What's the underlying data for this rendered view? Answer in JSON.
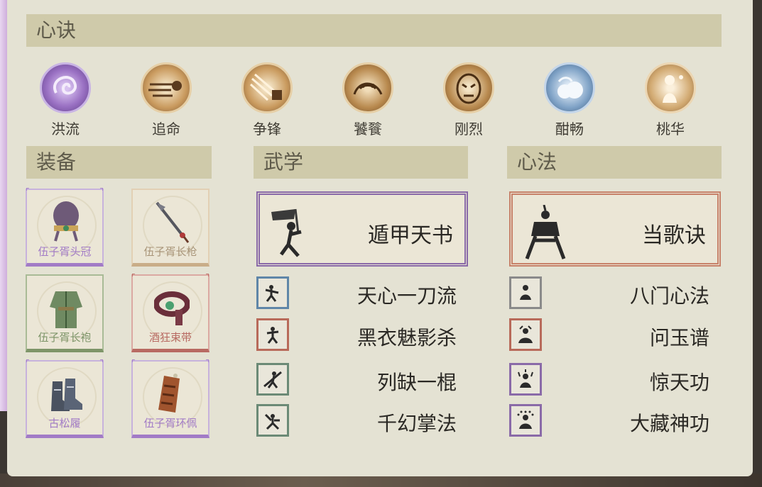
{
  "xinjue": {
    "title": "心诀",
    "items": [
      {
        "label": "洪流",
        "color": "#9b72c4",
        "icon": "swirl-icon"
      },
      {
        "label": "追命",
        "color": "#b78a52",
        "icon": "dash-icon"
      },
      {
        "label": "争锋",
        "color": "#b78a52",
        "icon": "strike-icon"
      },
      {
        "label": "饕餮",
        "color": "#a87a46",
        "icon": "beast-icon"
      },
      {
        "label": "刚烈",
        "color": "#a87a46",
        "icon": "mask-icon"
      },
      {
        "label": "酣畅",
        "color": "#6d8fb3",
        "icon": "cloud-icon"
      },
      {
        "label": "桃华",
        "color": "#c7a06a",
        "icon": "maiden-icon"
      }
    ]
  },
  "equipment": {
    "title": "装备",
    "items": [
      {
        "name": "伍子胥头冠",
        "color": "#a27bc6",
        "icon": "crown-icon"
      },
      {
        "name": "伍子胥长枪",
        "color": "#b49a7a",
        "icon": "spear-icon"
      },
      {
        "name": "伍子胥长袍",
        "color": "#7d9468",
        "icon": "robe-icon"
      },
      {
        "name": "酒狂束带",
        "color": "#b86a62",
        "icon": "belt-icon"
      },
      {
        "name": "古松履",
        "color": "#a27bc6",
        "icon": "boots-icon"
      },
      {
        "name": "伍子胥环佩",
        "color": "#a27bc6",
        "icon": "pendant-icon"
      }
    ]
  },
  "wuxue": {
    "title": "武学",
    "main": {
      "name": "遁甲天书",
      "color": "#8a6aa8"
    },
    "skills": [
      {
        "name": "天心一刀流",
        "color": "#5f86a8"
      },
      {
        "name": "黑衣魅影杀",
        "color": "#b86a5a"
      },
      {
        "name": "列缺一棍",
        "color": "#6b8a76"
      },
      {
        "name": "千幻掌法",
        "color": "#6b8a76"
      }
    ]
  },
  "xinfa": {
    "title": "心法",
    "main": {
      "name": "当歌诀",
      "color": "#c7826a"
    },
    "skills": [
      {
        "name": "八门心法",
        "color": "#8a8a8a"
      },
      {
        "name": "问玉谱",
        "color": "#b86a5a"
      },
      {
        "name": "惊天功",
        "color": "#8a6aa8"
      },
      {
        "name": "大藏神功",
        "color": "#8a6aa8"
      }
    ]
  }
}
